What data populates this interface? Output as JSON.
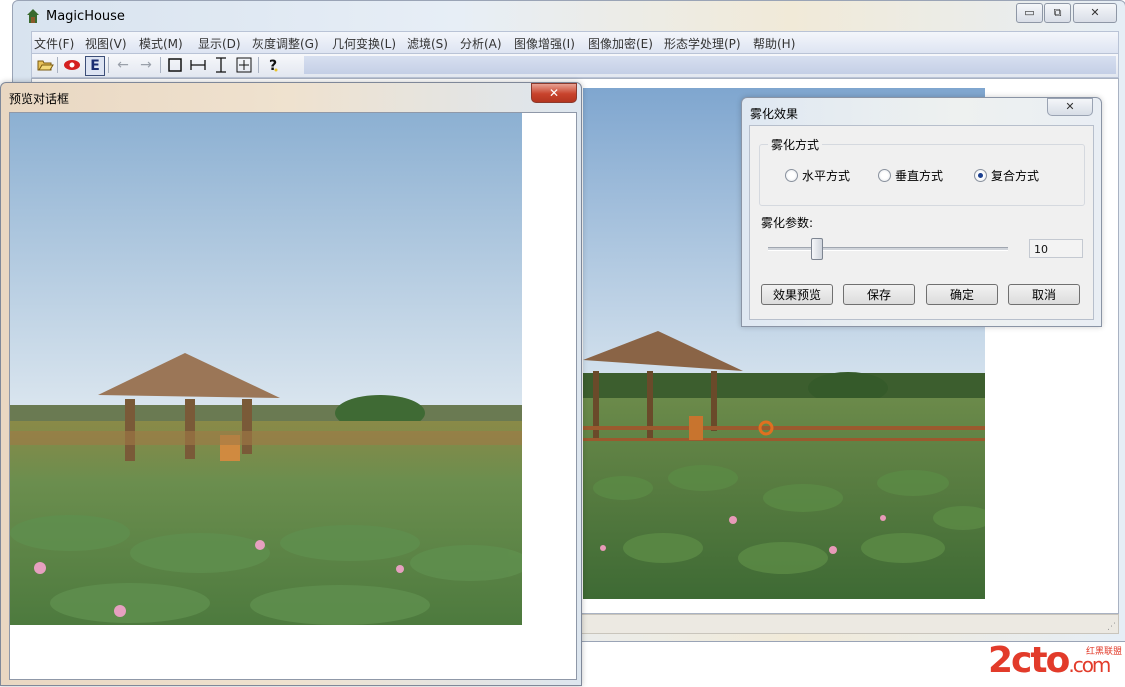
{
  "main_window": {
    "title": "MagicHouse",
    "controls": {
      "minimize": "▭",
      "maximize": "⧉",
      "close": "✕"
    }
  },
  "menu": {
    "items": [
      "文件(F)",
      "视图(V)",
      "模式(M)",
      "显示(D)",
      "灰度调整(G)",
      "几何变换(L)",
      "滤境(S)",
      "分析(A)",
      "图像增强(I)",
      "图像加密(E)",
      "形态学处理(P)",
      "帮助(H)"
    ]
  },
  "toolbar": {
    "icons": [
      "open-folder-icon",
      "eye-icon",
      "e-icon",
      "arrow-left-icon",
      "arrow-right-icon",
      "rectangle-icon",
      "fit-width-icon",
      "fit-height-icon",
      "fit-window-icon",
      "help-icon"
    ],
    "e_label": "E"
  },
  "preview_dialog": {
    "title": "预览对话框",
    "close": "✕"
  },
  "fog_dialog": {
    "title": "雾化效果",
    "close": "✕",
    "group_label": "雾化方式",
    "options": [
      {
        "label": "水平方式",
        "selected": false
      },
      {
        "label": "垂直方式",
        "selected": false
      },
      {
        "label": "复合方式",
        "selected": true
      }
    ],
    "param_label": "雾化参数:",
    "param_value": "10",
    "slider_fraction": 0.2,
    "buttons": {
      "preview": "效果预览",
      "save": "保存",
      "ok": "确定",
      "cancel": "取消"
    }
  },
  "watermark": {
    "text": "2cto",
    "suffix": ".com",
    "subtitle": "红黑联盟"
  },
  "colors": {
    "accent_red": "#e23b2a",
    "menu_text": "#333333"
  }
}
